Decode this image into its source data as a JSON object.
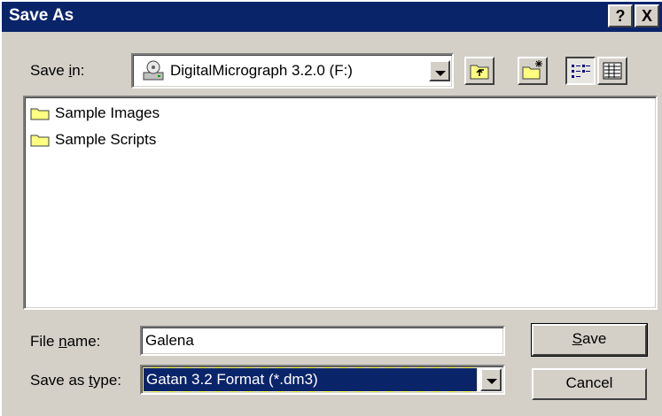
{
  "dialog": {
    "title": "Save As",
    "help_label": "?",
    "close_label": "X"
  },
  "save_in": {
    "label_pre": "Save ",
    "label_key": "i",
    "label_post": "n:",
    "value": "DigitalMicrograph 3.2.0 (F:)"
  },
  "toolbar": {
    "buttons": [
      "up-one-level",
      "create-new-folder",
      "list-view",
      "details-view"
    ]
  },
  "files": [
    {
      "name": "Sample Images",
      "icon": "folder-icon"
    },
    {
      "name": "Sample Scripts",
      "icon": "folder-icon"
    }
  ],
  "file_name": {
    "label_pre": "File ",
    "label_key": "n",
    "label_post": "ame:",
    "value": "Galena"
  },
  "save_type": {
    "label_pre": "Save as ",
    "label_key": "t",
    "label_post": "ype:",
    "value": "Gatan 3.2 Format (*.dm3)"
  },
  "buttons": {
    "save_key": "S",
    "save_rest": "ave",
    "cancel": "Cancel"
  },
  "colors": {
    "title_bar": "#0a246a",
    "face": "#d4d0c8",
    "selection": "#0a246a"
  }
}
